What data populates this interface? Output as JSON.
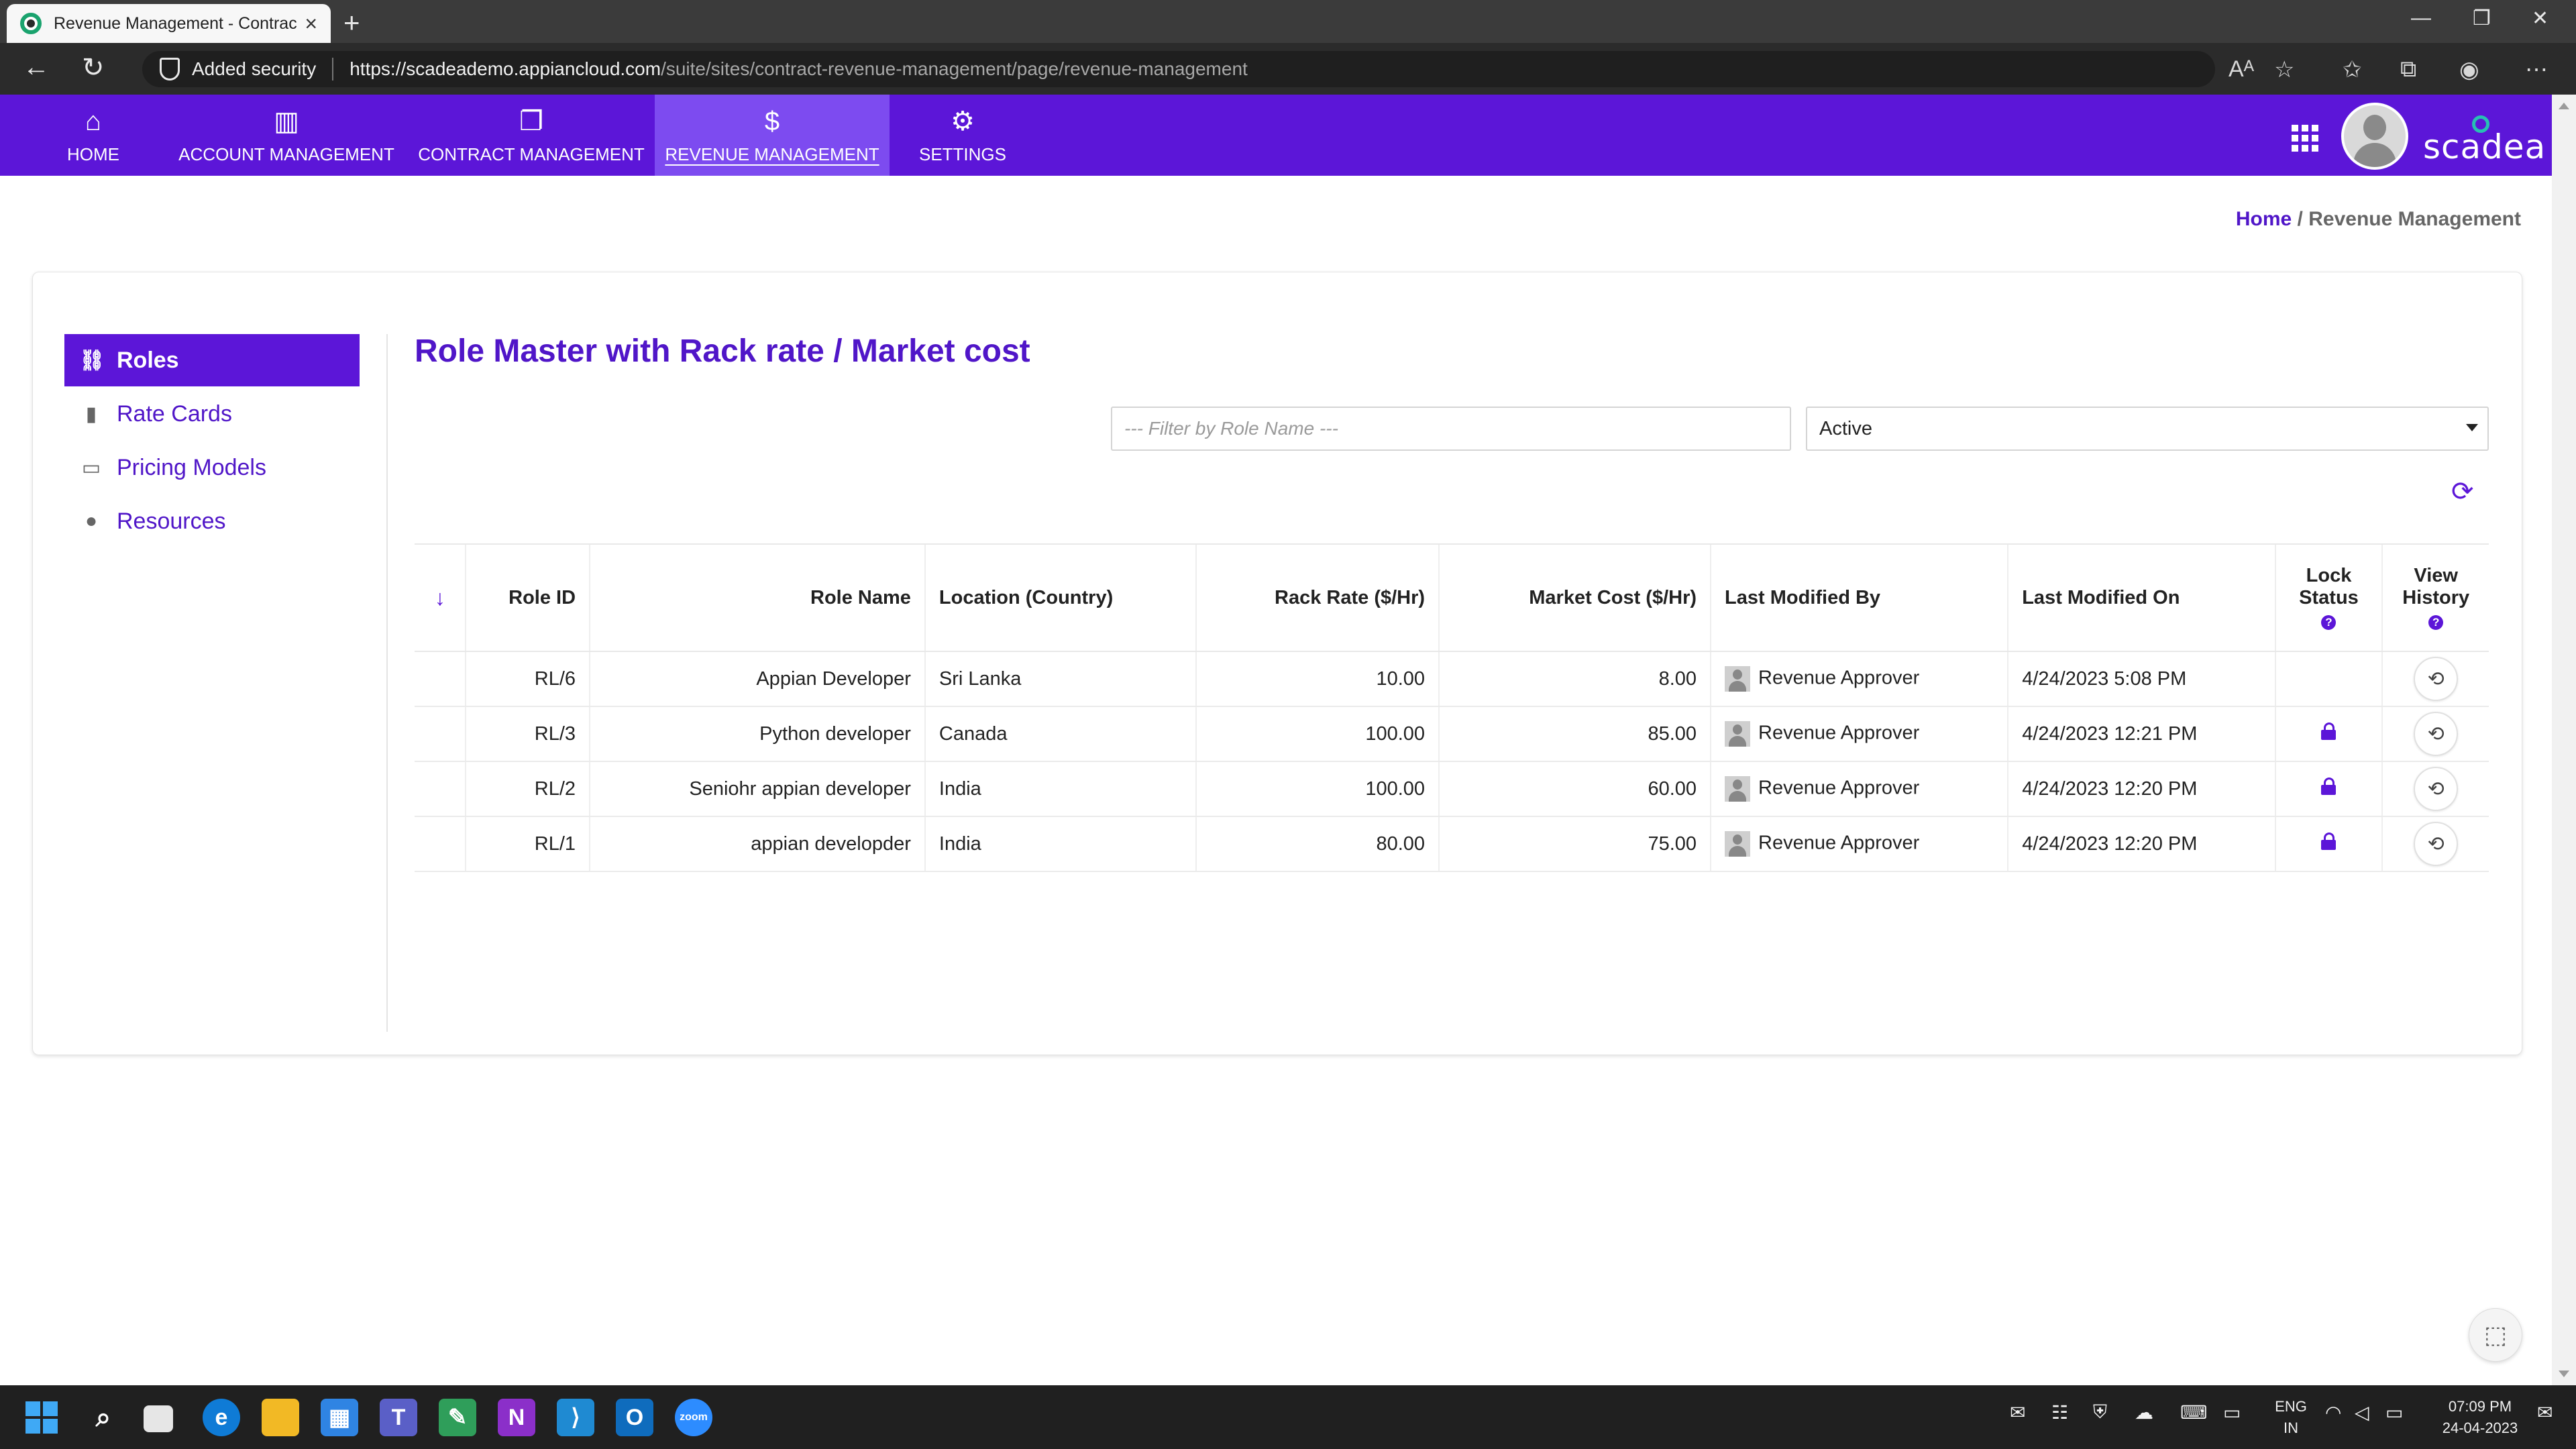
{
  "browser": {
    "tab_title": "Revenue Management - Contrac",
    "security_label": "Added security",
    "url_host": "https://scadeademo.appiancloud.com",
    "url_path": "/suite/sites/contract-revenue-management/page/revenue-management"
  },
  "nav": {
    "items": [
      {
        "label": "HOME",
        "icon": "home-icon"
      },
      {
        "label": "ACCOUNT MANAGEMENT",
        "icon": "building-icon"
      },
      {
        "label": "CONTRACT MANAGEMENT",
        "icon": "documents-icon"
      },
      {
        "label": "REVENUE MANAGEMENT",
        "icon": "dollar-icon",
        "active": true
      },
      {
        "label": "SETTINGS",
        "icon": "gear-icon"
      }
    ],
    "brand": "scadea"
  },
  "breadcrumb": {
    "home": "Home",
    "separator": " / ",
    "current": "Revenue Management"
  },
  "sidebar": {
    "items": [
      {
        "label": "Roles",
        "icon": "roles-icon",
        "active": true
      },
      {
        "label": "Rate Cards",
        "icon": "file-icon"
      },
      {
        "label": "Pricing Models",
        "icon": "money-icon"
      },
      {
        "label": "Resources",
        "icon": "user-icon"
      }
    ]
  },
  "page": {
    "title": "Role Master with Rack rate / Market cost",
    "filter_placeholder": "--- Filter by Role Name ---",
    "status_value": "Active"
  },
  "table": {
    "headers": {
      "sort": "↓",
      "role_id": "Role ID",
      "role_name": "Role Name",
      "location": "Location (Country)",
      "rack_rate": "Rack Rate ($/Hr)",
      "market_cost": "Market Cost ($/Hr)",
      "modified_by": "Last Modified By",
      "modified_on": "Last Modified On",
      "lock_status_1": "Lock",
      "lock_status_2": "Status",
      "view_history_1": "View",
      "view_history_2": "History"
    },
    "rows": [
      {
        "role_id": "RL/6",
        "role_name": "Appian Developer",
        "location": "Sri Lanka",
        "rack_rate": "10.00",
        "market_cost": "8.00",
        "modified_by": "Revenue Approver",
        "modified_on": "4/24/2023 5:08 PM",
        "locked": false
      },
      {
        "role_id": "RL/3",
        "role_name": "Python developer",
        "location": "Canada",
        "rack_rate": "100.00",
        "market_cost": "85.00",
        "modified_by": "Revenue Approver",
        "modified_on": "4/24/2023 12:21 PM",
        "locked": true
      },
      {
        "role_id": "RL/2",
        "role_name": "Seniohr appian developer",
        "location": "India",
        "rack_rate": "100.00",
        "market_cost": "60.00",
        "modified_by": "Revenue Approver",
        "modified_on": "4/24/2023 12:20 PM",
        "locked": true
      },
      {
        "role_id": "RL/1",
        "role_name": "appian developder",
        "location": "India",
        "rack_rate": "80.00",
        "market_cost": "75.00",
        "modified_by": "Revenue Approver",
        "modified_on": "4/24/2023 12:20 PM",
        "locked": true
      }
    ]
  },
  "taskbar": {
    "lang_1": "ENG",
    "lang_2": "IN",
    "time": "07:09 PM",
    "date": "24-04-2023"
  },
  "colors": {
    "brand_purple": "#5c16d8",
    "active_nav": "#7d4bf0",
    "link_purple": "#5016c8"
  }
}
